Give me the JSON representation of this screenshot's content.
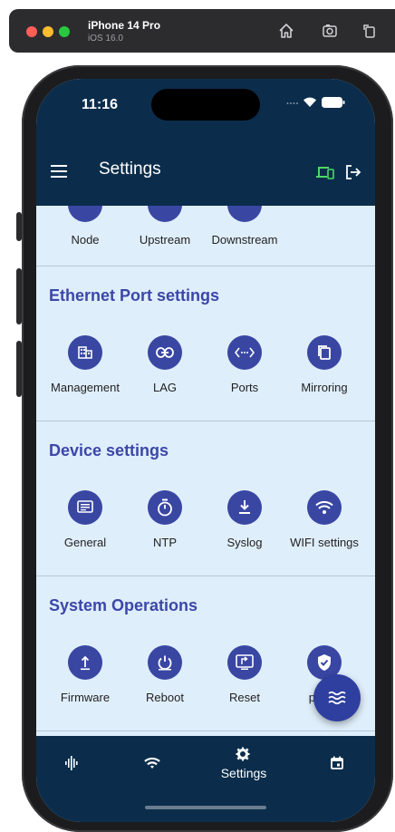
{
  "simulator": {
    "device_name": "iPhone 14 Pro",
    "os_version": "iOS 16.0",
    "icons": [
      "home-icon",
      "screenshot-icon",
      "rotate-icon"
    ]
  },
  "status_bar": {
    "time": "11:16"
  },
  "app_bar": {
    "title": "Settings",
    "icons": [
      "menu-icon",
      "devices-icon",
      "logout-icon"
    ],
    "devices_icon_color": "#4cd964"
  },
  "sections": {
    "top_partial": {
      "items": [
        {
          "label": "Node",
          "icon": "node-icon"
        },
        {
          "label": "Upstream",
          "icon": "upstream-icon"
        },
        {
          "label": "Downstream",
          "icon": "downstream-icon"
        }
      ]
    },
    "ethernet": {
      "title": "Ethernet Port settings",
      "items": [
        {
          "label": "Management",
          "icon": "building-icon"
        },
        {
          "label": "LAG",
          "icon": "link-icon"
        },
        {
          "label": "Ports",
          "icon": "ports-icon"
        },
        {
          "label": "Mirroring",
          "icon": "copy-icon"
        }
      ]
    },
    "device": {
      "title": "Device settings",
      "items": [
        {
          "label": "General",
          "icon": "list-icon"
        },
        {
          "label": "NTP",
          "icon": "timer-icon"
        },
        {
          "label": "Syslog",
          "icon": "download-icon"
        },
        {
          "label": "WIFI settings",
          "icon": "wifi-icon"
        }
      ]
    },
    "system": {
      "title": "System Operations",
      "items": [
        {
          "label": "Firmware",
          "icon": "upload-icon"
        },
        {
          "label": "Reboot",
          "icon": "power-icon"
        },
        {
          "label": "Reset",
          "icon": "reset-icon"
        },
        {
          "label": "pa",
          "icon": "shield-check-icon"
        }
      ]
    }
  },
  "fab": {
    "icon": "waves-icon"
  },
  "bottom_nav": {
    "items": [
      {
        "icon": "signal-icon",
        "label": ""
      },
      {
        "icon": "wifi-nav-icon",
        "label": ""
      },
      {
        "icon": "gear-icon",
        "label": "Settings"
      },
      {
        "icon": "calendar-icon",
        "label": ""
      }
    ]
  },
  "colors": {
    "app_bar": "#0b2d4b",
    "content_bg": "#dfeefb",
    "accent": "#3947a3",
    "section_title": "#3b47a8"
  }
}
